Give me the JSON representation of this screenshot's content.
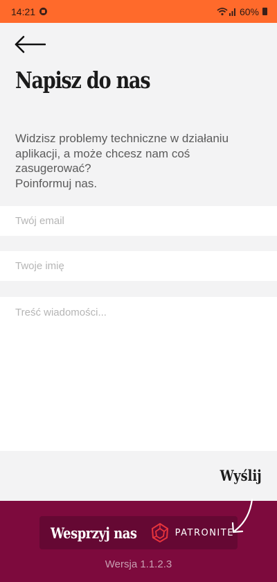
{
  "status_bar": {
    "time": "14:21",
    "signal_icons": "wifi-signal-icon",
    "battery": "60%"
  },
  "header": {
    "back_icon": "arrow-left-icon",
    "title": "Napisz do nas"
  },
  "description": {
    "lines": [
      "Widzisz problemy techniczne w działaniu",
      "aplikacji, a może chcesz nam coś",
      "zasugerować?",
      "Poinformuj nas."
    ]
  },
  "form": {
    "email_placeholder": "Twój email",
    "email_value": "",
    "name_placeholder": "Twoje imię",
    "name_value": "",
    "message_placeholder": "Treść wiadomości...",
    "message_value": "",
    "send_label": "Wyślij"
  },
  "footer": {
    "support_label": "Wesprzyj nas",
    "patronite_label": "PATRONITE",
    "version": "Wersja 1.1.2.3"
  },
  "colors": {
    "status_bar": "#ff6a2b",
    "background": "#f3f3f4",
    "footer": "#7d0a3d",
    "support_button": "#650833",
    "patronite_logo": "#e8343c"
  }
}
